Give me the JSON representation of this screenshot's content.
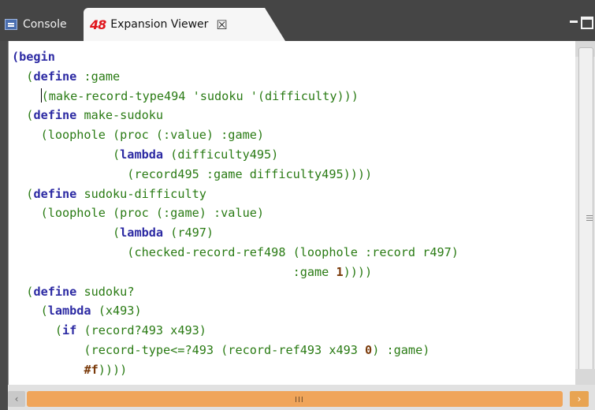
{
  "tabs": [
    {
      "label": "Console",
      "icon": "console-icon"
    },
    {
      "label": "Expansion Viewer",
      "icon": "scheme48-logo",
      "logo_text": "48",
      "close_icon": "close-icon"
    }
  ],
  "accent": "#e0141b",
  "code_lines": [
    [
      [
        "kw",
        "(begin"
      ]
    ],
    [
      [
        "p",
        "  ("
      ],
      [
        "kw",
        "define"
      ],
      [
        "p",
        " :game"
      ]
    ],
    [
      [
        "cursor",
        ""
      ],
      [
        "p",
        "(make-record-type494 'sudoku '(difficulty)))"
      ]
    ],
    [
      [
        "p",
        "  ("
      ],
      [
        "kw",
        "define"
      ],
      [
        "p",
        " make-sudoku"
      ]
    ],
    [
      [
        "p",
        "    (loophole (proc (:value) :game)"
      ]
    ],
    [
      [
        "p",
        "              ("
      ],
      [
        "kw",
        "lambda"
      ],
      [
        "p",
        " (difficulty495)"
      ]
    ],
    [
      [
        "p",
        "                (record495 :game difficulty495))))"
      ]
    ],
    [
      [
        "p",
        "  ("
      ],
      [
        "kw",
        "define"
      ],
      [
        "p",
        " sudoku-difficulty"
      ]
    ],
    [
      [
        "p",
        "    (loophole (proc (:game) :value)"
      ]
    ],
    [
      [
        "p",
        "              ("
      ],
      [
        "kw",
        "lambda"
      ],
      [
        "p",
        " (r497)"
      ]
    ],
    [
      [
        "p",
        "                (checked-record-ref498 (loophole :record r497)"
      ]
    ],
    [
      [
        "p",
        "                                       :game "
      ],
      [
        "lit",
        "1"
      ],
      [
        "p",
        "))))"
      ]
    ],
    [
      [
        "p",
        "  ("
      ],
      [
        "kw",
        "define"
      ],
      [
        "p",
        " sudoku?"
      ]
    ],
    [
      [
        "p",
        "    ("
      ],
      [
        "kw",
        "lambda"
      ],
      [
        "p",
        " (x493)"
      ]
    ],
    [
      [
        "p",
        "      ("
      ],
      [
        "kw",
        "if"
      ],
      [
        "p",
        " (record?493 x493)"
      ]
    ],
    [
      [
        "p",
        "          (record-type<=?493 (record-ref493 x493 "
      ],
      [
        "lit",
        "0"
      ],
      [
        "p",
        ") :game)"
      ]
    ],
    [
      [
        "p",
        "          "
      ],
      [
        "lit",
        "#f"
      ],
      [
        "p",
        "))))"
      ]
    ]
  ],
  "scrollbar": {
    "grip_label": "III"
  }
}
